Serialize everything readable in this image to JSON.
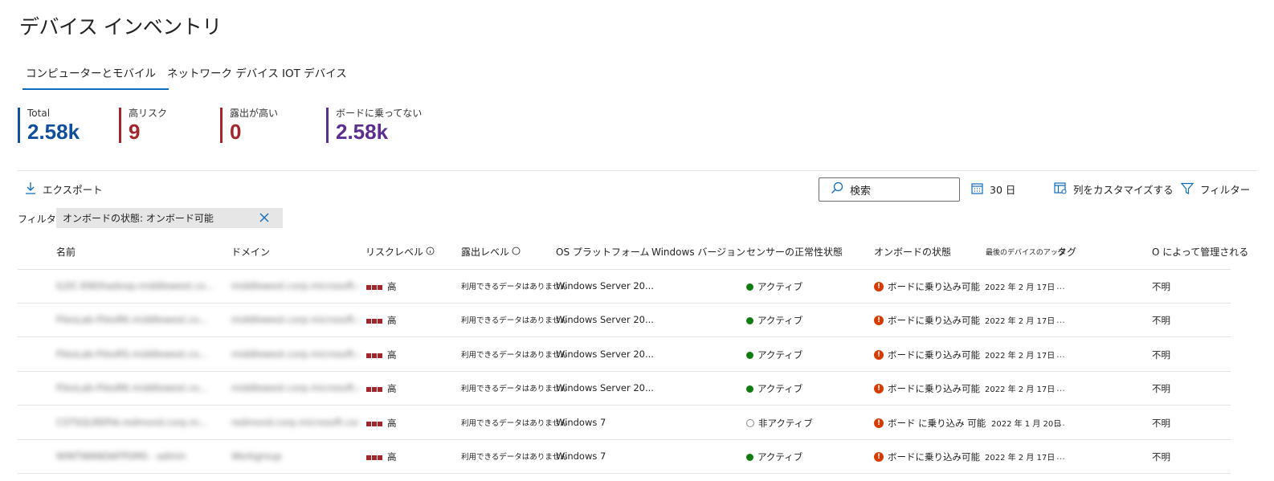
{
  "page_title": "デバイス インベントリ",
  "tabs": [
    {
      "label": "コンピューターとモバイル",
      "active": true
    },
    {
      "label": "ネットワーク デバイス",
      "active": false
    },
    {
      "label": "IOT デバイス",
      "active": false
    }
  ],
  "stats": [
    {
      "label": "Total",
      "value": "2.58k",
      "color": "#0f4f9c"
    },
    {
      "label": "高リスク",
      "value": "9",
      "color": "#a4262c"
    },
    {
      "label": "露出が高い",
      "value": "0",
      "color": "#a4262c"
    },
    {
      "label": "ボードに乗ってない",
      "value": "2.58k",
      "color": "#5c2e91"
    }
  ],
  "toolbar": {
    "export_label": "エクスポート",
    "search_placeholder": "検索",
    "date_range_label": "30 日",
    "customize_columns_label": "列をカスタマイズする",
    "filter_label": "フィルター"
  },
  "active_filter": {
    "prefix": "フィルター:",
    "text": "オンボードの状態: オンボード可能"
  },
  "columns": {
    "name": "名前",
    "domain": "ドメイン",
    "risk_level": "リスクレベル",
    "exposure_level": "露出レベル",
    "os_platform": "OS プラットフォーム",
    "windows_version": "Windows バージョン",
    "sensor_health": "センサーの正常性状態",
    "onboarding_status": "オンボードの状態",
    "last_device_update": "最後のデバイスのアップ",
    "tags": "タグ",
    "managed_by": "O によって管理される"
  },
  "rows": [
    {
      "name": "ILDC-ENGhadoop.middlewest.co...",
      "domain": "middlewest.corp.microsoft.co...",
      "risk": "高",
      "exposure": "利用できるデータはありません",
      "os": "Windows Server 20...",
      "sensor": "アクティブ",
      "sensor_active": true,
      "onboarding": "ボードに乗り込み可能",
      "last_update": "2022 年 2 月 17日",
      "tags": "...",
      "managed_by": "不明"
    },
    {
      "name": "FilesLab-FilesRK.middlewest.co...",
      "domain": "middlewest.corp.microsoft.co...",
      "risk": "高",
      "exposure": "利用できるデータはありません",
      "os": "Windows Server 20...",
      "sensor": "アクティブ",
      "sensor_active": true,
      "onboarding": "ボードに乗り込み可能",
      "last_update": "2022 年 2 月 17日",
      "tags": "...",
      "managed_by": "不明"
    },
    {
      "name": "FilesLab-FilesRS.middlewest.co...",
      "domain": "middlewest.corp.microsoft.co...",
      "risk": "高",
      "exposure": "利用できるデータはありません",
      "os": "Windows Server 20...",
      "sensor": "アクティブ",
      "sensor_active": true,
      "onboarding": "ボードに乗り込み可能",
      "last_update": "2022 年 2 月 17日",
      "tags": "...",
      "managed_by": "不明"
    },
    {
      "name": "FilesLab-FilesRK.middlewest.co...",
      "domain": "middlewest.corp.microsoft.co...",
      "risk": "高",
      "exposure": "利用できるデータはありません",
      "os": "Windows Server 20...",
      "sensor": "アクティブ",
      "sensor_active": true,
      "onboarding": "ボードに乗り込み可能",
      "last_update": "2022 年 2 月 17日",
      "tags": "...",
      "managed_by": "不明"
    },
    {
      "name": "CSTSQLREPIA.redmond.corp.m...",
      "domain": "redmond.corp.microsoft.com",
      "risk": "高",
      "exposure": "利用できるデータはありません",
      "os": "Windows 7",
      "sensor": "非アクティブ",
      "sensor_active": false,
      "onboarding": "ボード に乗り込み 可能",
      "last_update": "2022 年 1 月 20日",
      "tags": "...",
      "managed_by": "不明"
    },
    {
      "name": "WINTWANDAFPOMS - admin",
      "domain": "Workgroup",
      "risk": "高",
      "exposure": "利用できるデータはありません",
      "os": "Windows 7",
      "sensor": "アクティブ",
      "sensor_active": true,
      "onboarding": "ボードに乗り込み可能",
      "last_update": "2022 年 2 月 17日",
      "tags": "...",
      "managed_by": "不明"
    }
  ]
}
